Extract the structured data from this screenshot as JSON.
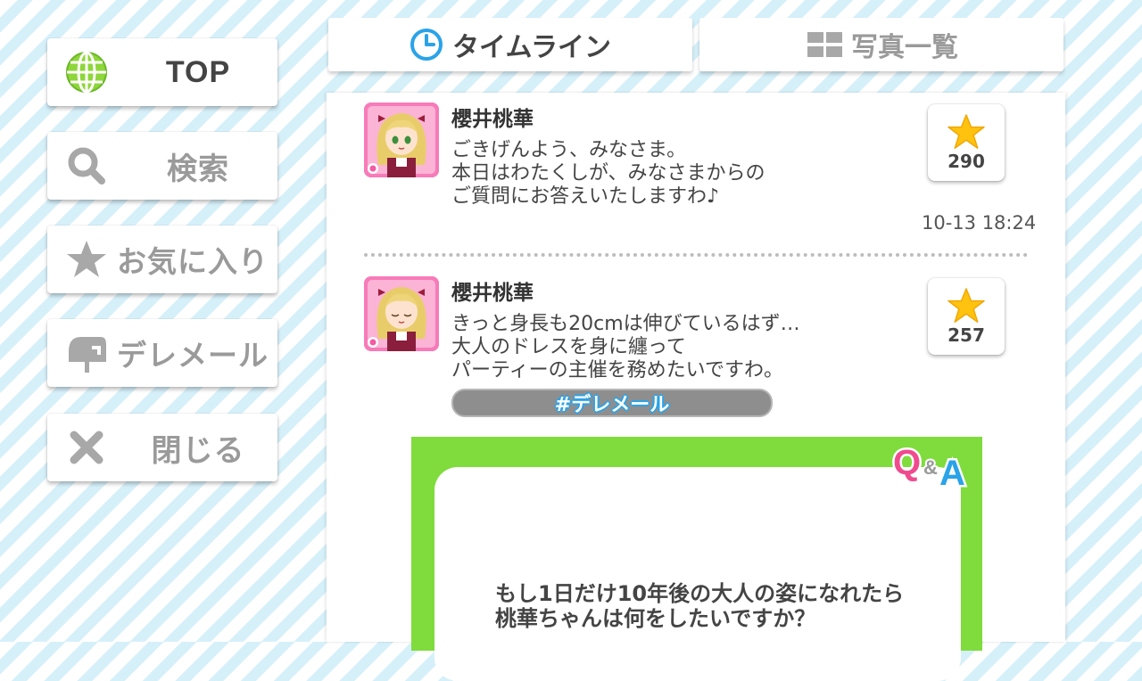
{
  "sidebar": {
    "items": [
      {
        "label": "TOP",
        "icon": "globe-icon"
      },
      {
        "label": "検索",
        "icon": "search-icon"
      },
      {
        "label": "お気に入り",
        "icon": "star-icon"
      },
      {
        "label": "デレメール",
        "icon": "mailbox-icon"
      },
      {
        "label": "閉じる",
        "icon": "close-icon"
      }
    ]
  },
  "tabs": [
    {
      "label": "タイムライン",
      "icon": "clock-icon",
      "active": true
    },
    {
      "label": "写真一覧",
      "icon": "grid-icon",
      "active": false
    }
  ],
  "posts": [
    {
      "author": "櫻井桃華",
      "lines": [
        "ごきげんよう、みなさま。",
        "本日はわたくしが、みなさまからの",
        "ご質問にお答えいたしますわ♪"
      ],
      "likes": "290",
      "timestamp": "10-13 18:24"
    },
    {
      "author": "櫻井桃華",
      "lines": [
        "きっと身長も20cmは伸びているはず…",
        "大人のドレスを身に纏って",
        "パーティーの主催を務めたいですわ。"
      ],
      "likes": "257",
      "hashtag": "#デレメール",
      "qa": {
        "logo": "Q&A",
        "lines": [
          "もし1日だけ10年後の大人の姿になれたら",
          "桃華ちゃんは何をしたいですか？"
        ]
      }
    }
  ],
  "colors": {
    "accent_green": "#7fdc3c",
    "avatar_pink": "#f45aa5",
    "star_yellow": "#ffc20e",
    "hashtag_blue": "#2aa3e8",
    "stripe_blue": "#d6f0fa"
  }
}
